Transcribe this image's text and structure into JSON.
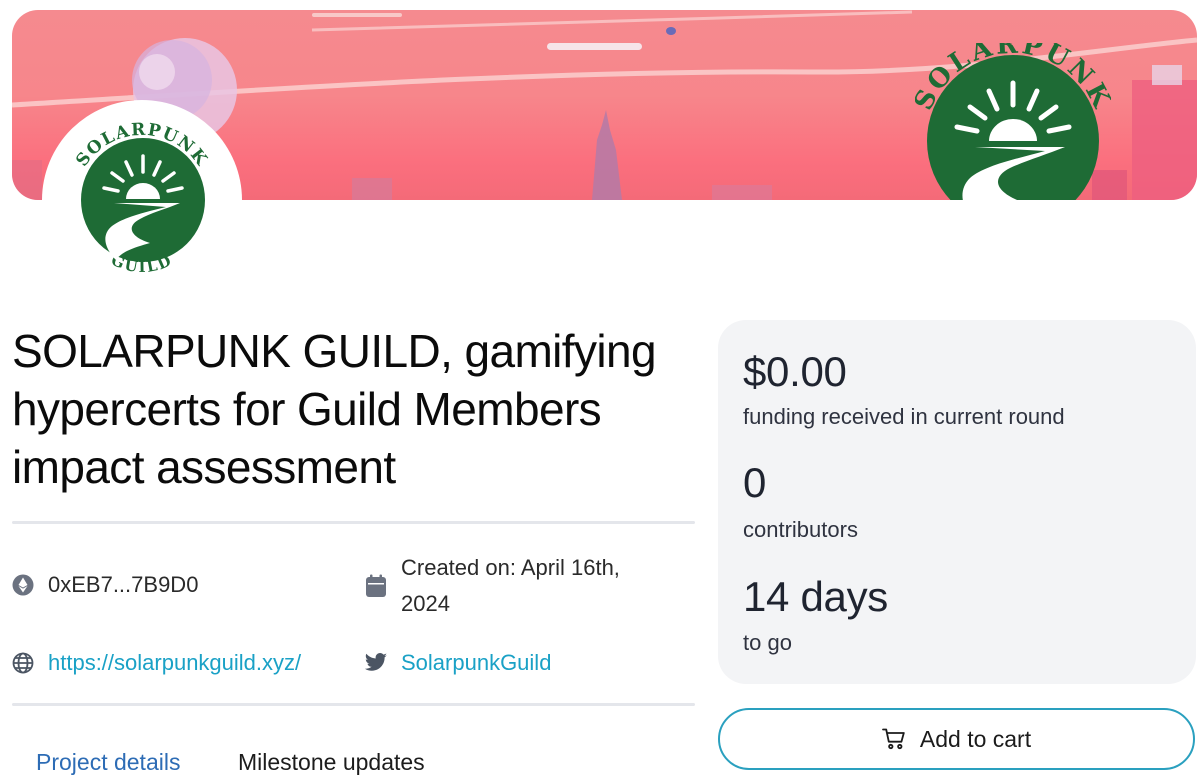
{
  "project": {
    "logo_text_top": "SOLARPUNK",
    "logo_text_bottom": "GUILD",
    "title": "SOLARPUNK GUILD, gamifying hypercerts for Guild Members impact assessment",
    "address": "0xEB7...7B9D0",
    "created_label": "Created on: April 16th, 2024",
    "website": "https://solarpunkguild.xyz/",
    "twitter": "SolarpunkGuild"
  },
  "tabs": [
    {
      "label": "Project details",
      "active": true
    },
    {
      "label": "Milestone updates",
      "active": false
    }
  ],
  "stats": {
    "funding_value": "$0.00",
    "funding_label": "funding received in current round",
    "contributors_value": "0",
    "contributors_label": "contributors",
    "time_value": "14 days",
    "time_label": "to go"
  },
  "cart": {
    "label": "Add to cart"
  },
  "icons": {
    "address": "ethereum-icon",
    "created": "calendar-icon",
    "website": "globe-icon",
    "twitter": "twitter-bird-icon",
    "cart": "shopping-cart-icon"
  },
  "colors": {
    "accent_link": "#1aa1c6",
    "tab_active": "#2d6cb5",
    "logo_green": "#1e6b35",
    "banner_pink": "#f7868b",
    "card_bg": "#f3f4f6",
    "button_border": "#2aa0bf"
  }
}
